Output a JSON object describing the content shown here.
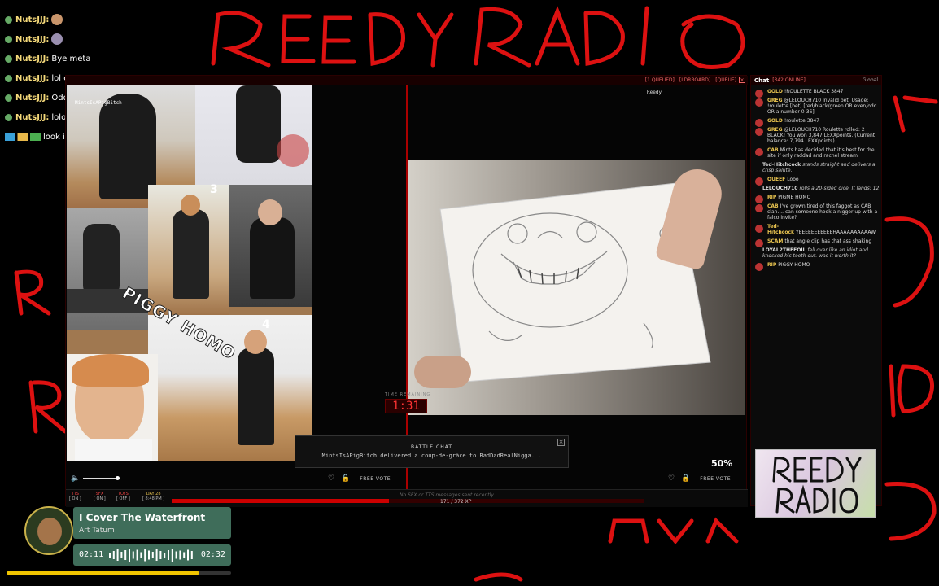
{
  "overlay_chat": [
    {
      "user": "NutsJJJ:",
      "msg": ""
    },
    {
      "user": "NutsJJJ:",
      "msg": ""
    },
    {
      "user": "NutsJJJ:",
      "msg": "Bye meta"
    },
    {
      "user": "NutsJJJ:",
      "msg": "lol cops meta"
    },
    {
      "user": "NutsJJJ:",
      "msg": "Oddbod W"
    },
    {
      "user": "NutsJJJ:",
      "msg": "lololol"
    },
    {
      "user": "",
      "msg": "look i was in ft chat"
    }
  ],
  "top_bar": {
    "left": "MintsIsAPigBitch",
    "queued": "[1 QUEUED]",
    "ldrboard": "[LDRBOARD]",
    "queue": "[QUEUE]",
    "close": "×"
  },
  "collage": {
    "overlay_text": "PIGGY HOMO",
    "num_3": "3",
    "num_4": "4"
  },
  "cam_tag": {
    "line1": "Reedy"
  },
  "timer": {
    "label": "TIME REMAINING",
    "value": "1:31"
  },
  "battle_chat": {
    "title": "BATTLE CHAT",
    "message": "MintsIsAPigBitch delivered a coup-de-grâce to RadDadRealNigga...",
    "close": "×"
  },
  "vote": {
    "percent": "50%",
    "free_vote_label": "FREE VOTE"
  },
  "status": {
    "tts": {
      "label": "TTS",
      "value": "[ ON ]"
    },
    "sfx": {
      "label": "SFX",
      "value": "[ ON ]"
    },
    "toys": {
      "label": "TOYS",
      "value": "[ OFF ]"
    },
    "day": {
      "label": "DAY 28",
      "value": "[ 8:48 PM ]"
    },
    "sfx_message": "No SFX or TTS messages sent recently...",
    "xp_text": "171 / 372 XP",
    "xp_fraction": 0.46
  },
  "chat": {
    "title": "Chat",
    "count": "[342 ONLINE]",
    "scope": "Global",
    "messages": [
      {
        "rank": "GOLD",
        "user": "",
        "text": "!ROULETTE BLACK 3847",
        "time": "",
        "sys": false
      },
      {
        "rank": "GREG",
        "user": "",
        "text": "@LELOUCH710 Invalid bet. Usage: !roulette [bet] [red/black/green OR even/odd OR a number 0-36]",
        "time": "",
        "sys": false
      },
      {
        "rank": "GOLD",
        "user": "",
        "text": "!roulette 3847",
        "time": "",
        "sys": false
      },
      {
        "rank": "GREG",
        "user": "",
        "text": "@LELOUCH710 Roulette rolled: 2 BLACK! You won 3,847 LEXXpoints. (Current balance: 7,794 LEXXpoints)",
        "time": "",
        "sys": false
      },
      {
        "rank": "CAB",
        "user": "",
        "text": "Mints has decided that it's best for the site if only raddad and rachel stream",
        "time": "",
        "sys": false
      },
      {
        "rank": "",
        "user": "Ted-Hitchcock",
        "text": "stands straight and delivers a crisp salute.",
        "time": "",
        "sys": true
      },
      {
        "rank": "QUEEF",
        "user": "",
        "text": "Looo",
        "time": "",
        "sys": false
      },
      {
        "rank": "",
        "user": "LELOUCH710",
        "text": "rolls a 20-sided dice. It lands: 12",
        "time": "",
        "sys": true
      },
      {
        "rank": "RIP",
        "user": "",
        "text": "PIGME HOMO",
        "time": "",
        "sys": false
      },
      {
        "rank": "CAB",
        "user": "",
        "text": "I've grown tired of this faggot as CAB clan.... can someone hook a nigger up with a falco invite?",
        "time": "",
        "sys": false
      },
      {
        "rank": "Ted-Hitchcock",
        "user": "",
        "text": "YEEEEEEEEEEEHAAAAAAAAAAW",
        "time": "",
        "sys": false
      },
      {
        "rank": "SCAM",
        "user": "",
        "text": "that angle clip has that ass shaking",
        "time": "",
        "sys": false
      },
      {
        "rank": "",
        "user": "LOYAL2THEFOIL",
        "text": "fell over like an idiot and knocked his teeth out. was it worth it?",
        "time": "",
        "sys": true
      },
      {
        "rank": "RIP",
        "user": "",
        "text": "PIGGY HOMO",
        "time": "",
        "sys": false
      }
    ]
  },
  "logo": {
    "text": "REEDY RADIO"
  },
  "music": {
    "title": "I Cover The Waterfront",
    "artist": "Art Tatum",
    "elapsed": "02:11",
    "total": "02:32",
    "progress_fraction": 0.86,
    "album_text": "ART TATUM"
  },
  "colors": {
    "accent": "#cc0000",
    "music_bg": "#3f6d5a",
    "music_progress": "#f0c400"
  }
}
